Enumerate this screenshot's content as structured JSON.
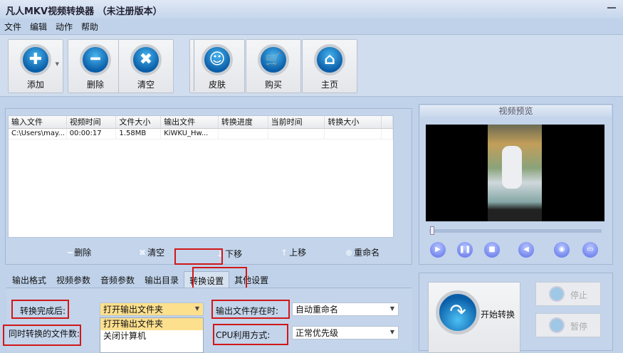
{
  "window": {
    "title": "凡人MKV视频转换器 （未注册版本）"
  },
  "menu": [
    "文件",
    "编辑",
    "动作",
    "帮助"
  ],
  "toolbar": {
    "add": "添加",
    "delete": "删除",
    "clear": "清空",
    "skin": "皮肤",
    "buy": "购买",
    "home": "主页"
  },
  "table": {
    "headers": [
      "输入文件",
      "视频时间",
      "文件大小",
      "输出文件",
      "转换进度",
      "当前时间",
      "转换大小"
    ],
    "rows": [
      [
        "C:\\Users\\may...",
        "00:00:17",
        "1.58MB",
        "KiWKU_Hw...",
        "",
        "",
        ""
      ]
    ]
  },
  "list_actions": {
    "delete": "删除",
    "clear": "清空",
    "down": "下移",
    "up": "上移",
    "rename": "重命名"
  },
  "tabs": [
    "输出格式",
    "视频参数",
    "音频参数",
    "输出目录",
    "转换设置",
    "其他设置"
  ],
  "settings": {
    "after_label": "转换完成后:",
    "after_value": "打开输出文件夹",
    "exists_label": "输出文件存在时:",
    "exists_value": "自动重命名",
    "concurrent_label": "同时转换的文件数:",
    "cpu_label": "CPU利用方式:",
    "cpu_value": "正常优先级",
    "dropdown_options": [
      "打开输出文件夹",
      "关闭计算机"
    ]
  },
  "preview": {
    "title": "视频预览",
    "seek_position": 0
  },
  "convert": {
    "start": "开始转换",
    "stop": "停止",
    "pause": "暂停"
  },
  "colors": {
    "background": "#bfd2ea",
    "highlight": "#d01818",
    "selected": "#fde08e"
  }
}
